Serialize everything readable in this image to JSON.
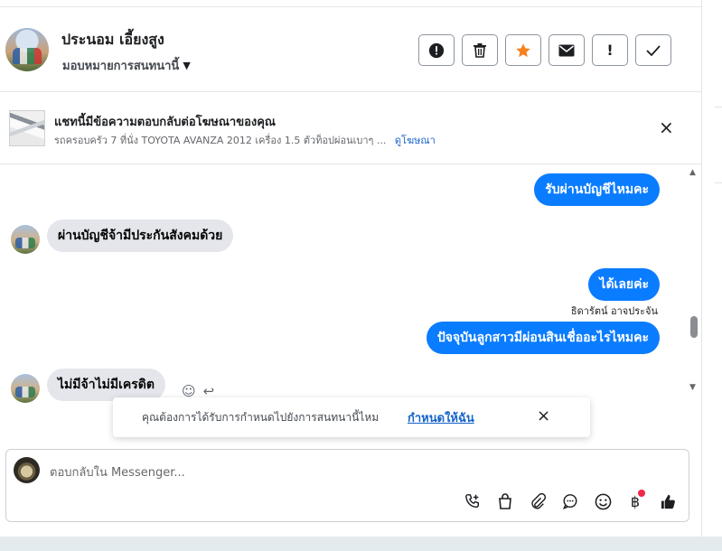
{
  "header": {
    "contact_name": "ประนอม เอี้ยงสูง",
    "assign_label": "มอบหมายการสนทนานี้",
    "actions": [
      {
        "name": "spam-button",
        "icon": "alert-circle-icon",
        "glyph": "!"
      },
      {
        "name": "delete-button",
        "icon": "trash-icon",
        "glyph": "🗑"
      },
      {
        "name": "star-button",
        "icon": "star-icon",
        "glyph": "★"
      },
      {
        "name": "mark-unread-button",
        "icon": "envelope-icon",
        "glyph": "✉"
      },
      {
        "name": "follow-up-button",
        "icon": "exclamation-icon",
        "glyph": "!"
      },
      {
        "name": "done-button",
        "icon": "check-icon",
        "glyph": "✓"
      }
    ]
  },
  "ad": {
    "title": "แชทนี้มีข้อความตอบกลับต่อโฆษณาของคุณ",
    "subtitle": "รถครอบครัว 7 ที่นั่ง TOYOTA AVANZA 2012 เครื่อง 1.5 ตัวท็อปผ่อนเบาๆ ...",
    "view_ad_link": "ดูโฆษณา",
    "close_glyph": "×"
  },
  "messages": [
    {
      "direction": "out",
      "text": "รับผ่านบัญชีไหมคะ"
    },
    {
      "direction": "in",
      "text": "ผ่านบัญชีจ้ามีประกันสังคมด้วย"
    },
    {
      "direction": "out",
      "text": "ได้เลยค่ะ"
    },
    {
      "direction": "out",
      "sender": "ธิดารัตน์ อาจประจัน",
      "text": "ปัจจุบันลูกสาวมีผ่อนสินเชื่ออะไรไหมคะ"
    },
    {
      "direction": "in",
      "text": "ไม่มีจ้าไม่มีเครดิต"
    }
  ],
  "toast": {
    "text": "คุณต้องการได้รับการกำหนดไปยังการสนทนานี้ไหม",
    "link": "กำหนดให้ฉัน",
    "close_glyph": "×"
  },
  "composer": {
    "placeholder": "ตอบกลับใน Messenger...",
    "tools": [
      {
        "name": "call-icon",
        "glyph": "📞"
      },
      {
        "name": "shopping-bag-icon",
        "glyph": "👜"
      },
      {
        "name": "paperclip-icon",
        "glyph": "📎"
      },
      {
        "name": "saved-reply-icon",
        "glyph": "💬"
      },
      {
        "name": "emoji-icon",
        "glyph": "☺"
      },
      {
        "name": "payment-baht-icon",
        "glyph": "฿"
      },
      {
        "name": "thumbs-up-icon",
        "glyph": "👍"
      }
    ]
  },
  "colors": {
    "accent_blue": "#0a7cff",
    "link_blue": "#1664c9",
    "incoming_bubble": "#e4e6eb",
    "star_orange": "#f5821f",
    "badge_red": "#f02849"
  }
}
